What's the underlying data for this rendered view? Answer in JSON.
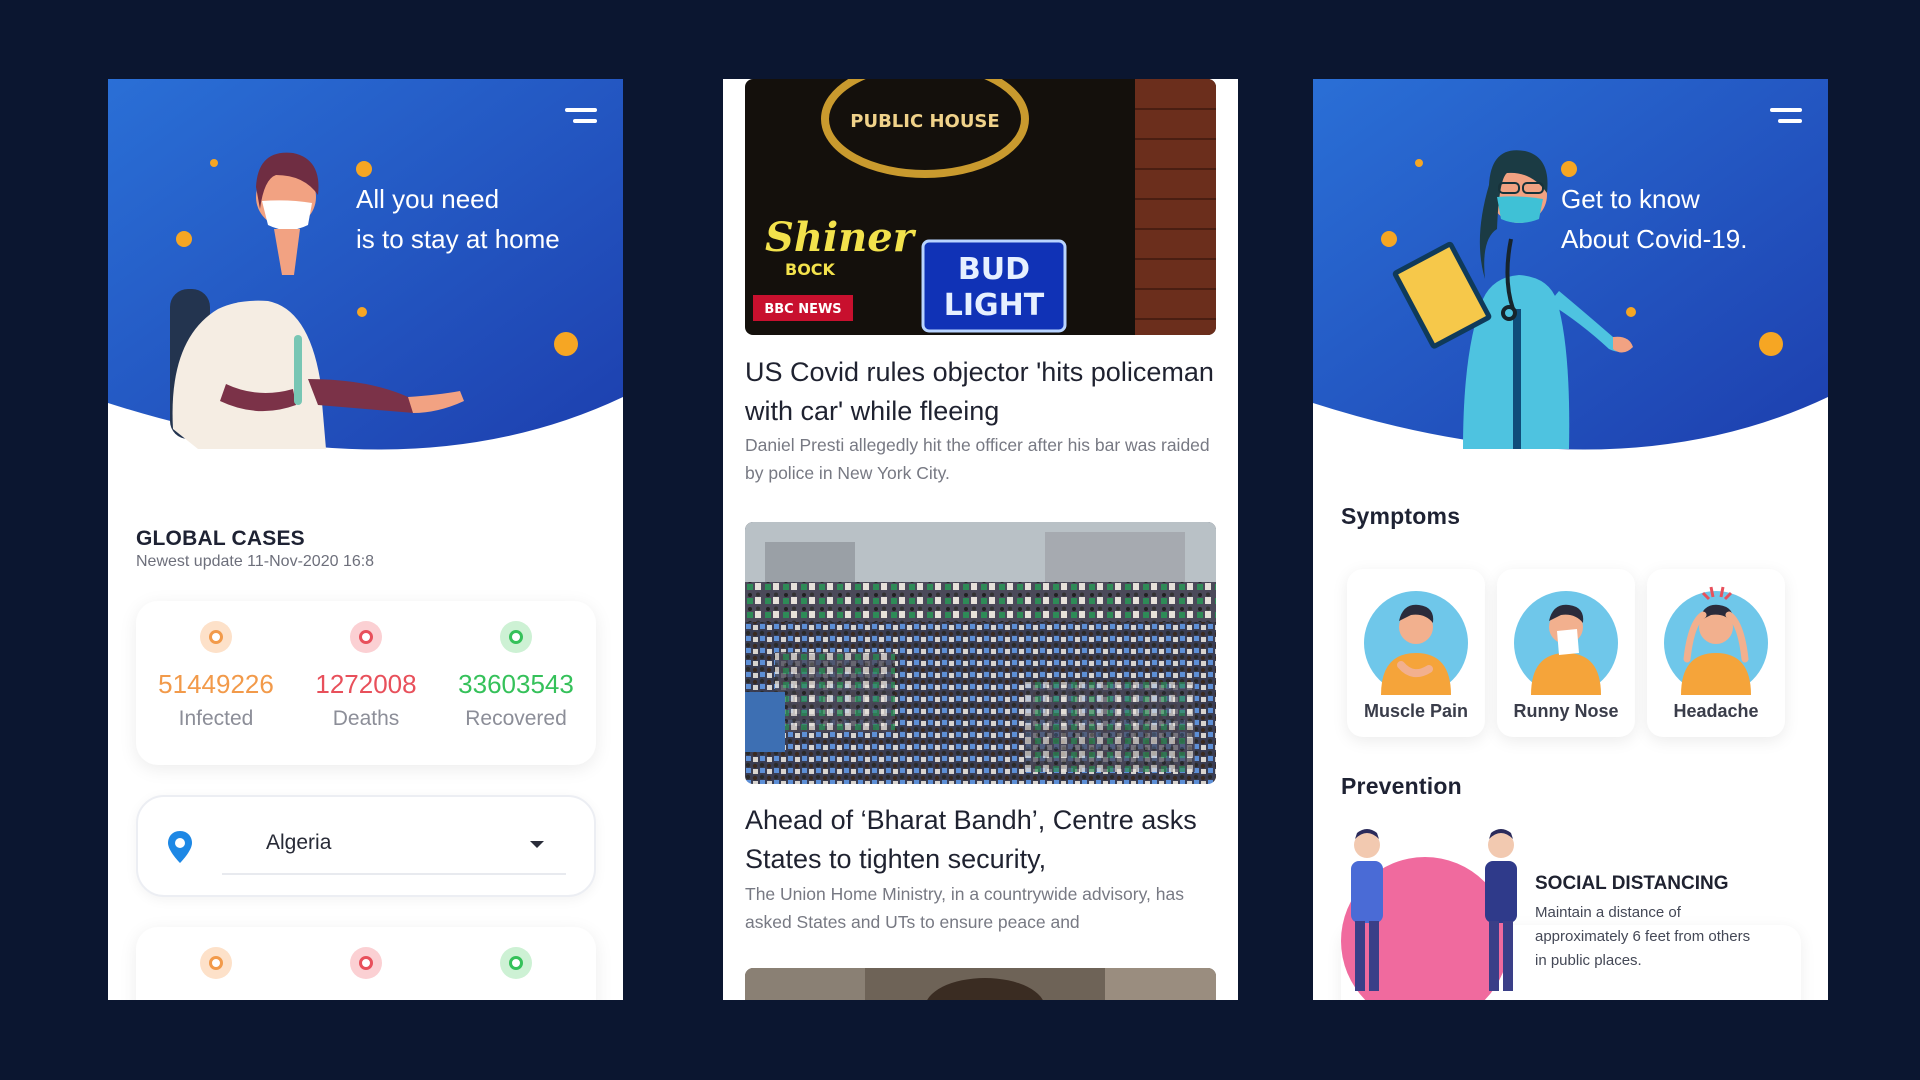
{
  "screen_left": {
    "header_line1": "All you need",
    "header_line2": "is to stay at home",
    "global_title": "GLOBAL CASES",
    "update_text": "Newest update 11-Nov-2020 16:8",
    "stats": [
      {
        "value": "51449226",
        "label": "Infected"
      },
      {
        "value": "1272008",
        "label": "Deaths"
      },
      {
        "value": "33603543",
        "label": "Recovered"
      }
    ],
    "country_selected": "Algeria"
  },
  "screen_middle": {
    "articles": [
      {
        "title": "US Covid rules objector 'hits policeman with car' while fleeing",
        "description": "Daniel Presti allegedly hit the officer after his bar was raided by police in New York City.",
        "image_caption": "BBC NEWS",
        "sign_public_house": "PUBLIC HOUSE",
        "sign_shiner": "Shiner",
        "sign_bock": "BOCK",
        "sign_bud": "BUD",
        "sign_light": "LIGHT"
      },
      {
        "title": "Ahead of ‘Bharat Bandh’, Centre asks States to tighten security,",
        "description": "The Union Home Ministry, in a countrywide advisory, has asked States and UTs to ensure peace and"
      }
    ]
  },
  "screen_right": {
    "header_line1": "Get to know",
    "header_line2": "About Covid-19.",
    "symptoms_title": "Symptoms",
    "symptoms": [
      {
        "label": "Muscle Pain"
      },
      {
        "label": "Runny Nose"
      },
      {
        "label": "Headache"
      }
    ],
    "prevention_title": "Prevention",
    "prevention_card_title": "SOCIAL DISTANCING",
    "prevention_card_text": "Maintain a distance of approximately 6 feet from others in public places."
  },
  "colors": {
    "background": "#0b1630",
    "header_blue": "#1f5bd0",
    "infected": "#f29a4a",
    "deaths": "#e8505b",
    "recovered": "#35c15a"
  }
}
